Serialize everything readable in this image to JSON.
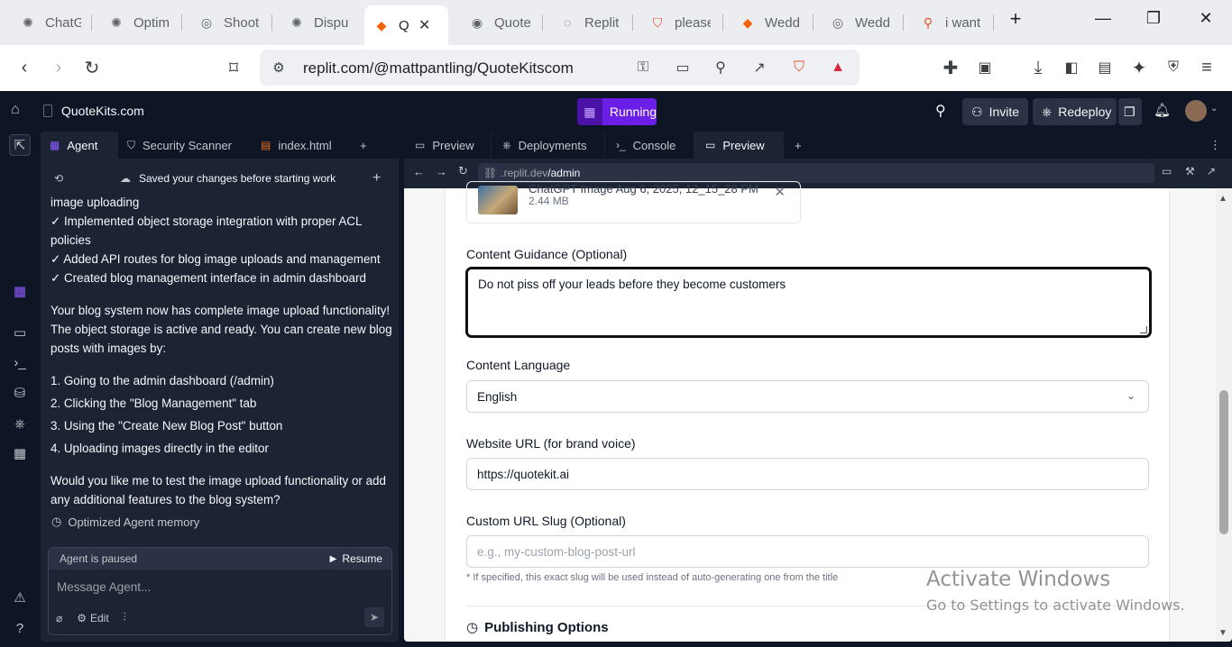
{
  "browser": {
    "tabs": [
      {
        "title": "ChatG",
        "icon": "openai-icon"
      },
      {
        "title": "Optim",
        "icon": "openai-icon"
      },
      {
        "title": "Shoot",
        "icon": "perplexity-icon"
      },
      {
        "title": "Dispu",
        "icon": "openai-icon"
      },
      {
        "title": "Q",
        "icon": "replit-icon",
        "active": true
      },
      {
        "title": "Quote",
        "icon": "globe-icon"
      },
      {
        "title": "Replit",
        "icon": "loading-icon"
      },
      {
        "title": "please",
        "icon": "brave-icon"
      },
      {
        "title": "Wedd",
        "icon": "replit-icon"
      },
      {
        "title": "Wedd",
        "icon": "perplexity-icon"
      },
      {
        "title": "i want",
        "icon": "brave-search-icon"
      }
    ],
    "url": "replit.com/@mattpantling/QuoteKitscom"
  },
  "replit": {
    "project_name": "QuoteKits.com",
    "run_status": "Running",
    "invite_label": "Invite",
    "redeploy_label": "Redeploy"
  },
  "agent_panel": {
    "tabs": [
      "Agent",
      "Security Scanner",
      "index.html"
    ],
    "saved_notice": "Saved your changes before starting work",
    "chat": {
      "line0": "image uploading",
      "check1": "✓ Implemented object storage integration with proper ACL policies",
      "check2": "✓ Added API routes for blog image uploads and management",
      "check3": "✓ Created blog management interface in admin dashboard",
      "para1": "Your blog system now has complete image upload functionality! The object storage is active and ready. You can create new blog posts with images by:",
      "step1": "1. Going to the admin dashboard (/admin)",
      "step2": "2. Clicking the \"Blog Management\" tab",
      "step3": "3. Using the \"Create New Blog Post\" button",
      "step4": "4. Uploading images directly in the editor",
      "para2": "Would you like me to test the image upload functionality or add any additional features to the blog system?"
    },
    "memory_label": "Optimized Agent memory",
    "status_text": "Agent is paused",
    "resume_label": "Resume",
    "message_placeholder": "Message Agent...",
    "edit_label": "Edit"
  },
  "workspace": {
    "tabs": [
      "Preview",
      "Deployments",
      "Console",
      "Preview"
    ],
    "address_domain": ".replit.dev",
    "address_path": "/admin",
    "form": {
      "file_name": "ChatGPT Image Aug 6, 2025, 12_15_28 PM",
      "file_size": "2.44 MB",
      "guidance_label": "Content Guidance (Optional)",
      "guidance_value": "Do not piss off your leads before they become customers",
      "language_label": "Content Language",
      "language_value": "English",
      "website_label": "Website URL (for brand voice)",
      "website_value": "https://quotekit.ai",
      "slug_label": "Custom URL Slug (Optional)",
      "slug_placeholder": "e.g., my-custom-blog-post-url",
      "slug_hint": "* If specified, this exact slug will be used instead of auto-generating one from the title",
      "publishing_heading": "Publishing Options"
    }
  },
  "watermark": {
    "line1": "Activate Windows",
    "line2": "Go to Settings to activate Windows."
  }
}
